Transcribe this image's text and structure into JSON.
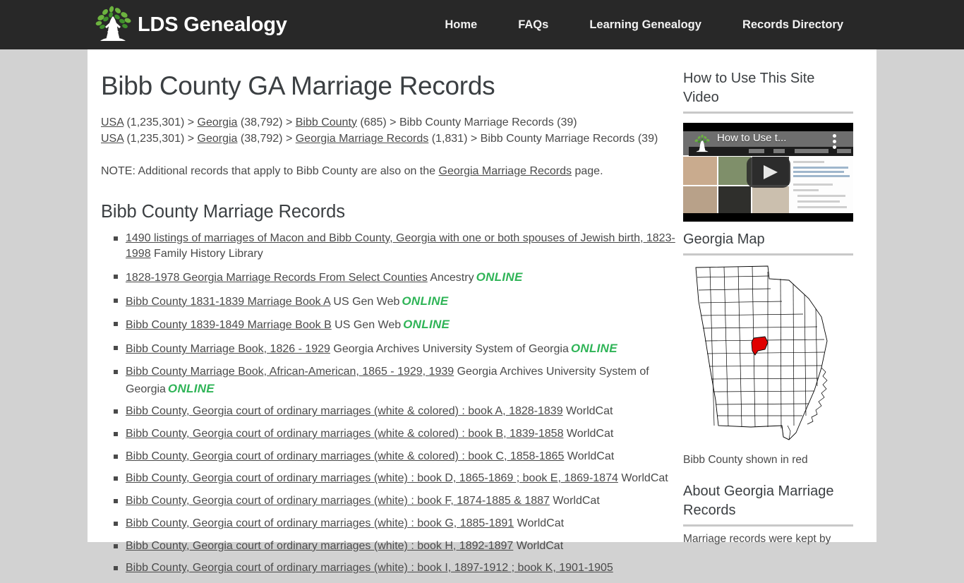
{
  "header": {
    "brand": "LDS Genealogy",
    "logo_icon": "tree-logo-icon",
    "nav": [
      {
        "label": "Home"
      },
      {
        "label": "FAQs"
      },
      {
        "label": "Learning Genealogy"
      },
      {
        "label": "Records Directory"
      }
    ]
  },
  "main": {
    "page_title": "Bibb County GA Marriage Records",
    "breadcrumb1": [
      {
        "text": "USA",
        "link": true
      },
      {
        "text": " (1,235,301) > ",
        "link": false
      },
      {
        "text": "Georgia",
        "link": true
      },
      {
        "text": " (38,792) > ",
        "link": false
      },
      {
        "text": "Bibb County",
        "link": true
      },
      {
        "text": " (685) > Bibb County Marriage Records (39)",
        "link": false
      }
    ],
    "breadcrumb2": [
      {
        "text": "USA",
        "link": true
      },
      {
        "text": " (1,235,301) > ",
        "link": false
      },
      {
        "text": "Georgia",
        "link": true
      },
      {
        "text": " (38,792) > ",
        "link": false
      },
      {
        "text": "Georgia Marriage Records",
        "link": true
      },
      {
        "text": " (1,831) > Bibb County Marriage Records (39)",
        "link": false
      }
    ],
    "note": [
      {
        "text": "NOTE: Additional records that apply to Bibb County are also on the ",
        "link": false
      },
      {
        "text": "Georgia Marriage Records",
        "link": true
      },
      {
        "text": " page.",
        "link": false
      }
    ],
    "section_heading": "Bibb County Marriage Records",
    "records": [
      {
        "title": "1490 listings of marriages of Macon and Bibb County, Georgia with one or both spouses of Jewish birth, 1823-1998",
        "source": "Family History Library",
        "online": ""
      },
      {
        "title": "1828-1978 Georgia Marriage Records From Select Counties",
        "source": "Ancestry",
        "online": "ONLINE"
      },
      {
        "title": "Bibb County 1831-1839 Marriage Book A",
        "source": "US Gen Web",
        "online": "ONLINE"
      },
      {
        "title": "Bibb County 1839-1849 Marriage Book B",
        "source": "US Gen Web",
        "online": "ONLINE"
      },
      {
        "title": "Bibb County Marriage Book, 1826 - 1929",
        "source": "Georgia Archives University System of Georgia",
        "online": "ONLINE"
      },
      {
        "title": "Bibb County Marriage Book, African-American, 1865 - 1929, 1939",
        "source": "Georgia Archives University System of Georgia",
        "online": "ONLINE"
      },
      {
        "title": "Bibb County, Georgia court of ordinary marriages (white & colored) : book A, 1828-1839",
        "source": "WorldCat",
        "online": ""
      },
      {
        "title": "Bibb County, Georgia court of ordinary marriages (white & colored) : book B, 1839-1858",
        "source": "WorldCat",
        "online": ""
      },
      {
        "title": "Bibb County, Georgia court of ordinary marriages (white & colored) : book C, 1858-1865",
        "source": "WorldCat",
        "online": ""
      },
      {
        "title": "Bibb County, Georgia court of ordinary marriages (white) : book D, 1865-1869 ; book E, 1869-1874",
        "source": "WorldCat",
        "online": ""
      },
      {
        "title": "Bibb County, Georgia court of ordinary marriages (white) : book F, 1874-1885 & 1887",
        "source": "WorldCat",
        "online": ""
      },
      {
        "title": "Bibb County, Georgia court of ordinary marriages (white) : book G, 1885-1891",
        "source": "WorldCat",
        "online": ""
      },
      {
        "title": "Bibb County, Georgia court of ordinary marriages (white) : book H, 1892-1897",
        "source": "WorldCat",
        "online": ""
      },
      {
        "title": "Bibb County, Georgia court of ordinary marriages (white) : book I, 1897-1912 ; book K, 1901-1905",
        "source": "",
        "online": ""
      }
    ]
  },
  "sidebar": {
    "video_heading": "How to Use This Site Video",
    "video_overlay_title": "How to Use t...",
    "video_play_icon": "play-icon",
    "map_heading": "Georgia Map",
    "map_caption": "Bibb County shown in red",
    "about_heading": "About Georgia Marriage Records",
    "about_text": "Marriage records were kept by"
  },
  "colors": {
    "header_bg": "#282828",
    "page_bg": "#d2d2d2",
    "content_bg": "#ffffff",
    "text": "#4a4a4a",
    "heading": "#3b3f42",
    "online_green": "#2fb457",
    "county_red": "#e00000",
    "rule_gray": "#c8c8c8"
  }
}
